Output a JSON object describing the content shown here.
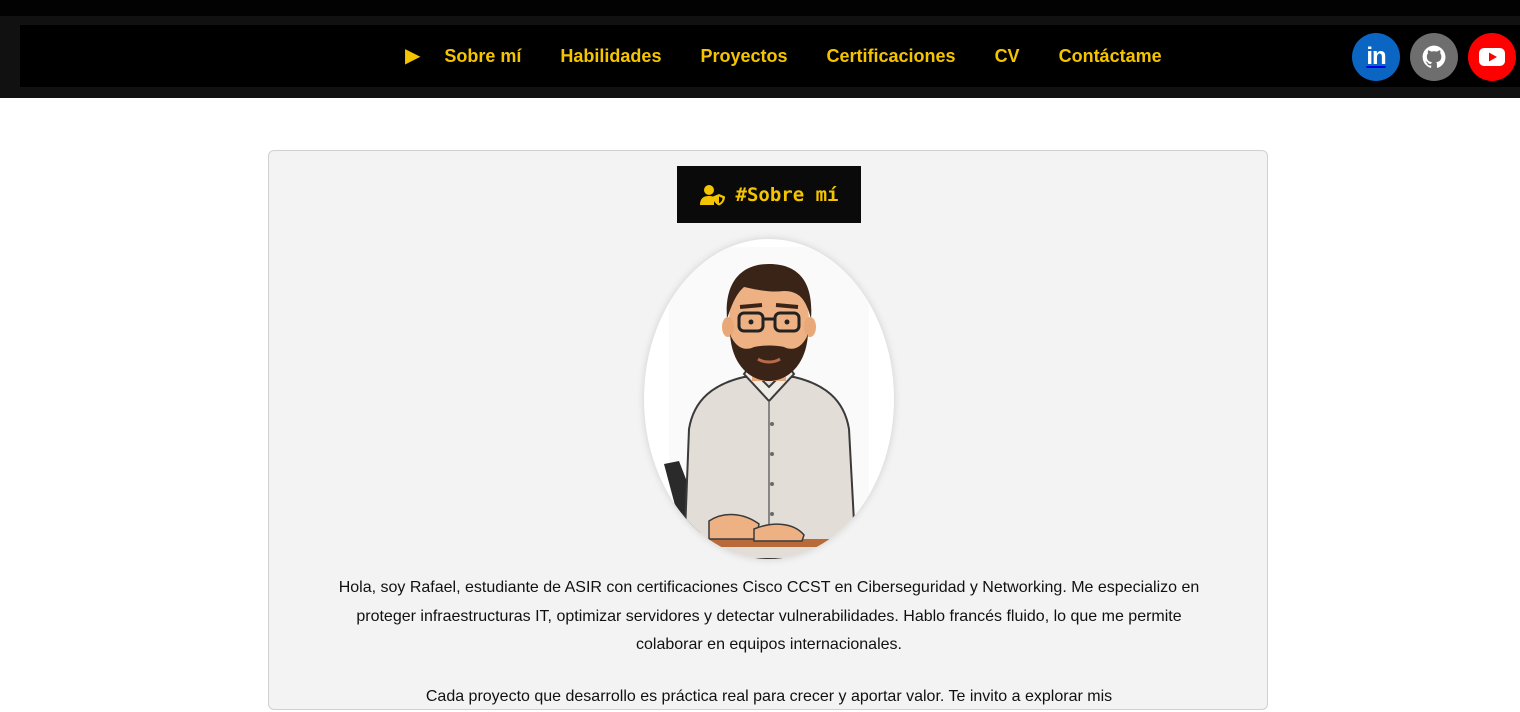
{
  "nav": {
    "arrow": "▶",
    "items": [
      "Sobre mí",
      "Habilidades",
      "Proyectos",
      "Certificaciones",
      "CV",
      "Contáctame"
    ]
  },
  "social": {
    "linkedin_label": "in",
    "icons": [
      "linkedin-icon",
      "github-icon",
      "youtube-icon"
    ]
  },
  "colors": {
    "accent": "#f5c400",
    "nav_bg": "#000000",
    "linkedin": "#0a66c2",
    "github": "#6e6e6e",
    "youtube": "#ff0000"
  },
  "about": {
    "title": "#Sobre mí",
    "title_icon": "user-shield-icon",
    "bio": "Hola, soy Rafael, estudiante de ASIR con certificaciones Cisco CCST en Ciberseguridad y Networking. Me especializo en proteger infraestructuras IT, optimizar servidores y detectar vulnerabilidades. Hablo francés fluido, lo que me permite colaborar en equipos internacionales.",
    "bio2": "Cada proyecto que desarrollo es práctica real para crecer y aportar valor. Te invito a explorar mis"
  }
}
